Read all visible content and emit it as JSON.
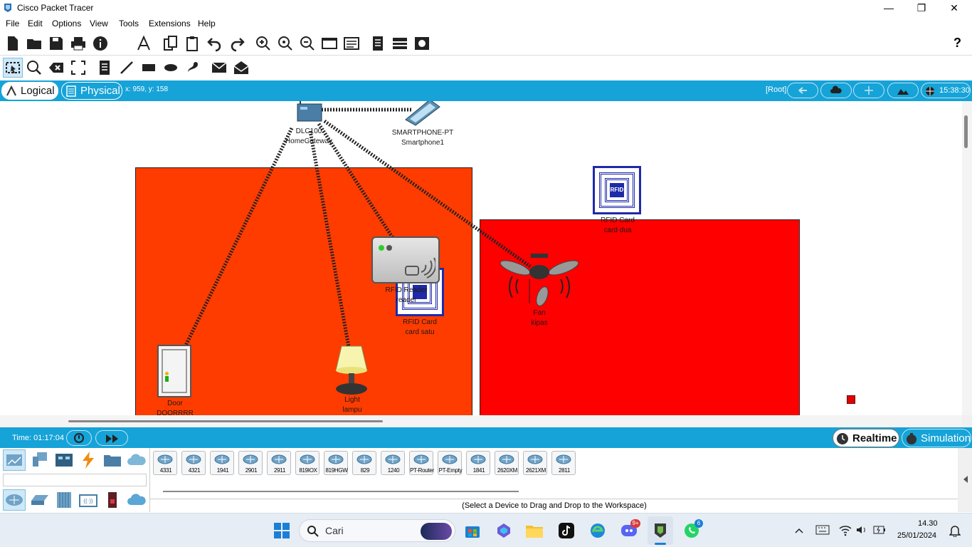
{
  "window": {
    "title": "Cisco Packet Tracer",
    "controls": {
      "minimize": "—",
      "maximize": "❐",
      "close": "✕"
    }
  },
  "menu": [
    "File",
    "Edit",
    "Options",
    "View",
    "Tools",
    "Extensions",
    "Help"
  ],
  "help_glyph": "?",
  "modes": {
    "logical": "Logical",
    "physical": "Physical",
    "coords": "x: 959, y: 158",
    "root": "[Root]",
    "clock": "15:38:30"
  },
  "workspace": {
    "devices": {
      "gateway": {
        "model": "DLC100",
        "name": "HomeGateway"
      },
      "smartphone": {
        "model": "SMARTPHONE-PT",
        "name": "Smartphone1"
      },
      "rfid_card_dua": {
        "model": "RFID Card",
        "name": "card dua",
        "badge": "RFID"
      },
      "rfid_reader": {
        "model": "RFID Reader",
        "name": "reader"
      },
      "rfid_card_satu": {
        "model": "RFID Card",
        "name": "card satu"
      },
      "fan": {
        "model": "Fan",
        "name": "kipas"
      },
      "door": {
        "model": "Door",
        "name": "DOORRRR"
      },
      "light": {
        "model": "Light",
        "name": "lampu"
      }
    },
    "colors": {
      "room_left": "#ff3c00",
      "room_right": "#ff0000",
      "link": "#222222"
    }
  },
  "timebar": {
    "time": "Time: 01:17:04",
    "realtime": "Realtime",
    "simulation": "Simulation"
  },
  "device_panel": {
    "routers": [
      "4331",
      "4321",
      "1941",
      "2901",
      "2911",
      "819IOX",
      "819HGW",
      "829",
      "1240",
      "PT-Router",
      "PT-Empty",
      "1841",
      "2620XM",
      "2621XM",
      "2811"
    ],
    "status": "(Select a Device to Drag and Drop to the Workspace)"
  },
  "taskbar": {
    "search": "Cari",
    "time": "14.30",
    "date": "25/01/2024",
    "discord_badge": "9+",
    "whatsapp_badge": "6"
  }
}
